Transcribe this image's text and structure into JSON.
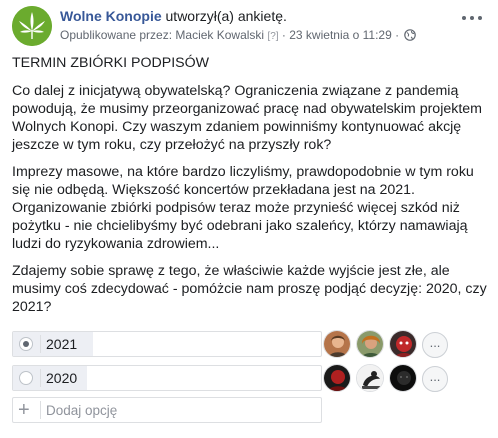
{
  "header": {
    "author": "Wolne Konopie",
    "action": "utworzył(a) ankietę.",
    "published_by": "Opublikowane przez: Maciek Kowalski",
    "help_mark": "[?]",
    "separator": "·",
    "date": "23 kwietnia o 11:29",
    "dot": "·"
  },
  "post": {
    "title": "TERMIN ZBIÓRKI PODPISÓW",
    "paragraph1": "Co dalej z inicjatywą obywatelską? Ograniczenia związane z pandemią powodują, że musimy przeorganizować pracę nad obywatelskim projektem Wolnych Konopi. Czy waszym zdaniem powinniśmy kontynuować akcję jeszcze w tym roku, czy przełożyć na przyszły rok?",
    "paragraph2": "Imprezy masowe, na które bardzo liczyliśmy, prawdopodobnie w tym roku się nie odbędą. Większość koncertów przekładana jest na 2021. Organizowanie zbiórki podpisów teraz może przynieść więcej szkód niż pożytku - nie chcielibyśmy być odebrani jako szaleńcy, którzy namawiają ludzi do ryzykowania zdrowiem...",
    "paragraph3": "Zdajemy sobie sprawę z tego, że właściwie każde wyjście jest złe, ale musimy coś zdecydować - pomóżcie nam proszę podjąć decyzję: 2020, czy 2021?"
  },
  "poll": {
    "options": [
      {
        "label": "2021",
        "selected": true,
        "vote_share": 0.26,
        "more": "..."
      },
      {
        "label": "2020",
        "selected": false,
        "vote_share": 0.24,
        "more": "..."
      }
    ],
    "add_placeholder": "Dodaj opcję",
    "add_icon": "+"
  },
  "colors": {
    "link": "#385898",
    "brand_green": "#6bab2e",
    "fill": "#edeff4",
    "border": "#dddfe2"
  },
  "icons": [
    "cannabis-leaf-logo",
    "globe-icon",
    "more-options-icon",
    "radio-icon",
    "plus-icon"
  ]
}
